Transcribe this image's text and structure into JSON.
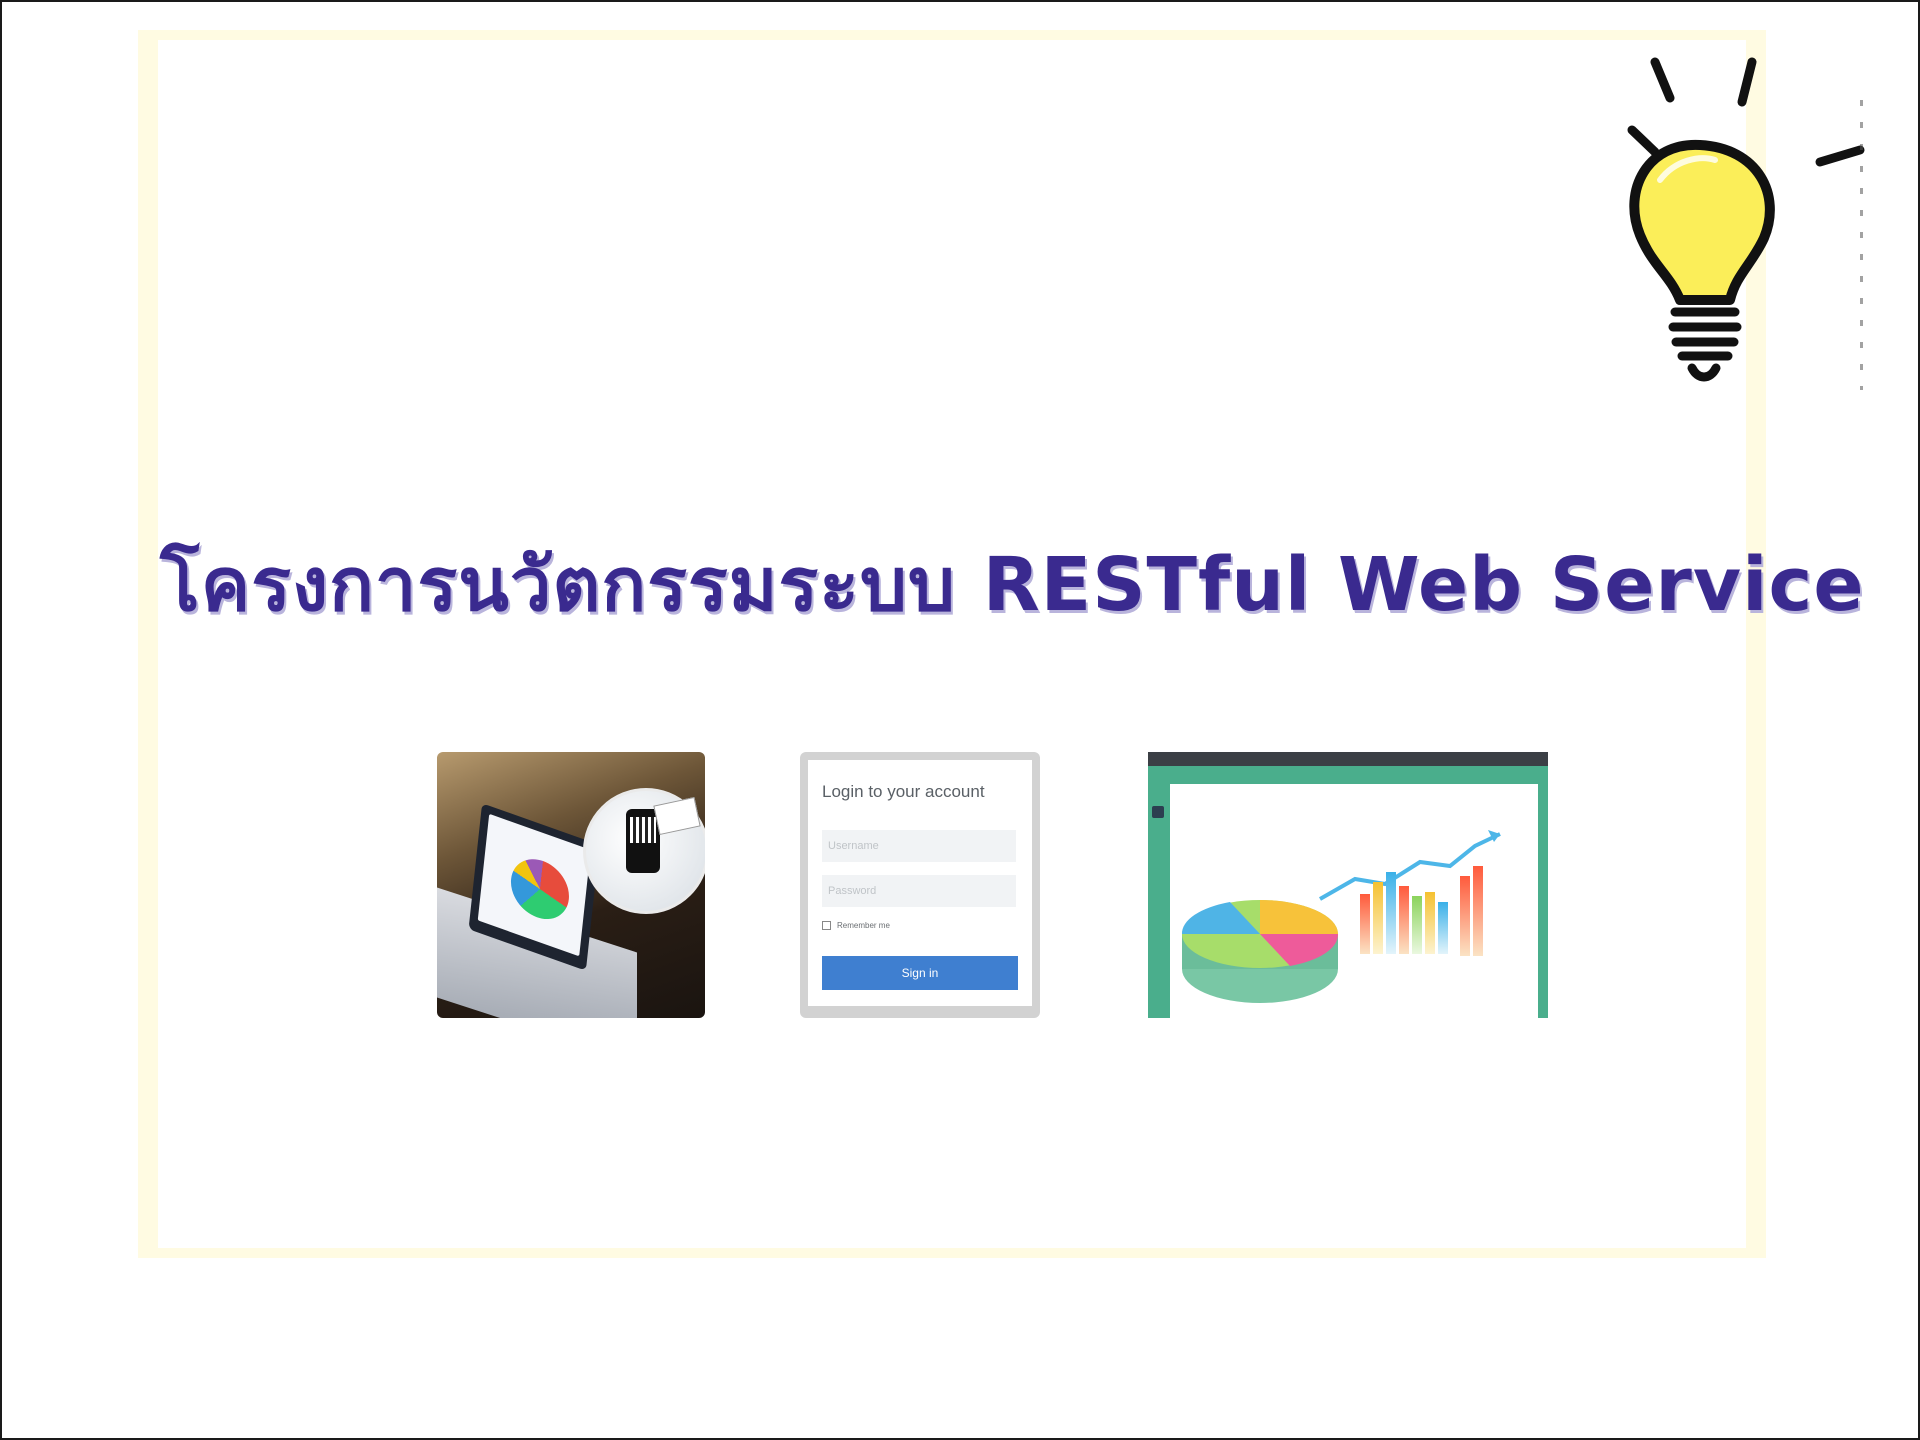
{
  "slide": {
    "title": "โครงการนวัตกรรมระบบ RESTful Web Service",
    "title_color": "#3a2a8f",
    "background_color": "#fffbe2"
  },
  "icons": {
    "decoration": "lightbulb-icon"
  },
  "thumbnails": [
    {
      "name": "laptop-pie-chart-photo"
    },
    {
      "name": "login-form-screenshot",
      "login": {
        "title": "Login to your account",
        "username_placeholder": "Username",
        "password_placeholder": "Password",
        "remember_label": "Remember me",
        "sign_in_label": "Sign in",
        "button_color": "#3f7fd0"
      }
    },
    {
      "name": "dashboard-chart-screenshot",
      "accent_color": "#4aae8c"
    }
  ]
}
